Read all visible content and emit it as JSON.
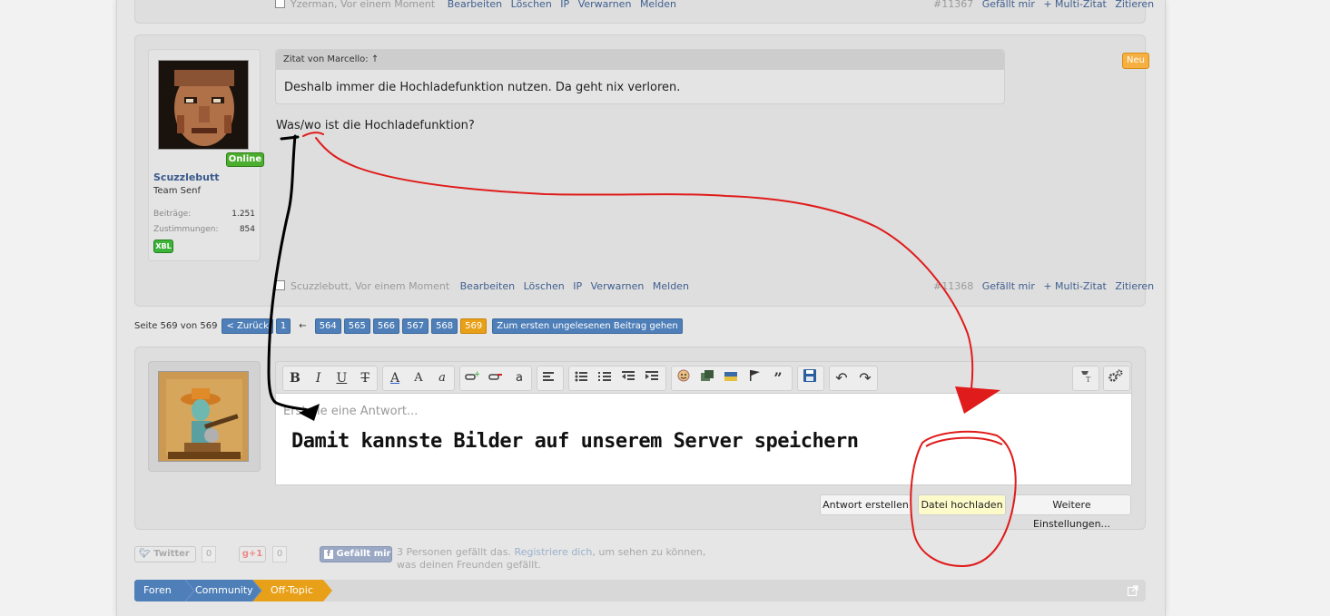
{
  "prev_post": {
    "author": "Yzerman, Vor einem Moment",
    "actions": [
      "Bearbeiten",
      "Löschen",
      "IP",
      "Verwarnen",
      "Melden"
    ],
    "number": "#11367",
    "right_actions": [
      "Gefällt mir",
      "+ Multi-Zitat",
      "Zitieren"
    ]
  },
  "post": {
    "user": {
      "name": "Scuzzlebutt",
      "title": "Team Senf",
      "online_badge": "Online",
      "stats": [
        {
          "label": "Beiträge:",
          "value": "1.251"
        },
        {
          "label": "Zustimmungen:",
          "value": "854"
        }
      ],
      "badge": "XBL"
    },
    "new_badge": "Neu",
    "quote": {
      "header": "Zitat von Marcello: ↑",
      "text": "Deshalb immer die Hochladefunktion nutzen. Da geht nix verloren."
    },
    "text": "Was/wo ist die Hochladefunktion?",
    "footer": {
      "author": "Scuzzlebutt, Vor einem Moment",
      "actions": [
        "Bearbeiten",
        "Löschen",
        "IP",
        "Verwarnen",
        "Melden"
      ],
      "number": "#11368",
      "right_actions": [
        "Gefällt mir",
        "+ Multi-Zitat",
        "Zitieren"
      ]
    }
  },
  "pagination": {
    "label": "Seite 569 von 569",
    "back": "< Zurück",
    "first": "1",
    "ellipsis": "←",
    "pages": [
      "564",
      "565",
      "566",
      "567",
      "568"
    ],
    "current": "569",
    "jump": "Zum ersten ungelesenen Beitrag gehen"
  },
  "reply": {
    "placeholder": "Erstelle eine Antwort...",
    "annotation_text": "Damit kannste Bilder auf unserem Server speichern",
    "buttons": [
      "Antwort erstellen",
      "Datei hochladen",
      "Weitere Einstellungen..."
    ],
    "toolbar": {
      "bold": "B",
      "italic": "I",
      "underline": "U",
      "strike": "T",
      "color": "A",
      "size": "A",
      "font": "a"
    }
  },
  "social": {
    "twitter": "Twitter",
    "twitter_count": "0",
    "gplus": "g+1",
    "gplus_count": "0",
    "fb": "Gefällt mir",
    "like_text_1": "3 Personen gefällt das.",
    "like_link": "Registriere dich",
    "like_text_2": ", um sehen zu können,",
    "like_text_3": "was deinen Freunden gefällt."
  },
  "breadcrumb": [
    "Foren",
    "Community",
    "Off-Topic"
  ],
  "colors": {
    "link_blue": "#3f5f8f",
    "page_blue": "#4f7fb8",
    "current_orange": "#e8a018",
    "annotation_red": "#e01b1b",
    "annotation_black": "#000000"
  }
}
